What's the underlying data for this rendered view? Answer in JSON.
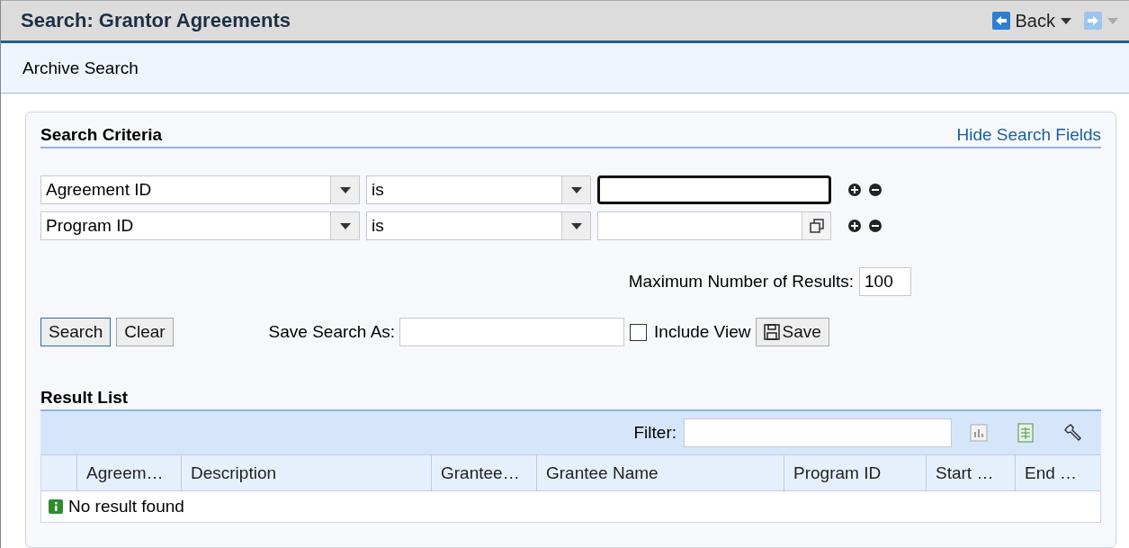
{
  "window": {
    "title": "Search: Grantor Agreements",
    "back_label": "Back"
  },
  "subheader": {
    "title": "Archive Search"
  },
  "criteria": {
    "title": "Search Criteria",
    "toggle_link": "Hide Search Fields",
    "rows": [
      {
        "field": "Agreement ID",
        "operator": "is",
        "focused": true,
        "value_help": false
      },
      {
        "field": "Program ID",
        "operator": "is",
        "focused": false,
        "value_help": true
      }
    ],
    "max_results_label": "Maximum Number of Results:",
    "max_results": "100"
  },
  "actions": {
    "search": "Search",
    "clear": "Clear",
    "save_as_label": "Save Search As:",
    "include_view": {
      "label": "Include View",
      "checked": false
    },
    "save": "Save"
  },
  "results": {
    "title": "Result List",
    "filter_label": "Filter:",
    "columns": [
      "Agreem…",
      "Description",
      "Grantee…",
      "Grantee Name",
      "Program ID",
      "Start …",
      "End …"
    ],
    "empty_message": "No result found"
  }
}
